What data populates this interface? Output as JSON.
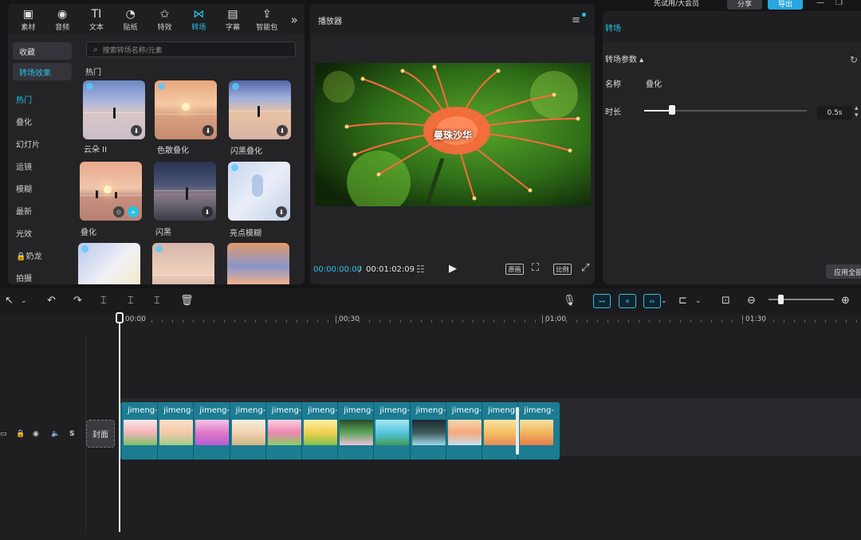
{
  "header": {
    "vip_text": "先试用/大会员",
    "share_label": "分享",
    "export_label": "导出"
  },
  "tabs": [
    {
      "label": "素材",
      "icon": "media-icon"
    },
    {
      "label": "音频",
      "icon": "audio-icon"
    },
    {
      "label": "文本",
      "icon": "text-icon",
      "glyph": "TI"
    },
    {
      "label": "贴纸",
      "icon": "sticker-icon"
    },
    {
      "label": "特效",
      "icon": "effects-icon"
    },
    {
      "label": "转场",
      "icon": "transition-icon",
      "active": true
    },
    {
      "label": "字幕",
      "icon": "subtitle-icon"
    },
    {
      "label": "智能包",
      "icon": "smart-pack-icon"
    }
  ],
  "sidebar": {
    "collect": "收藏",
    "transition_effects": "转场效果",
    "items": [
      "热门",
      "叠化",
      "幻灯片",
      "运镜",
      "模糊",
      "最新",
      "光效",
      "🔒奶龙",
      "拍摄"
    ]
  },
  "search": {
    "placeholder": "搜索转场名称/元素"
  },
  "section_title": "热门",
  "cards": [
    {
      "label": "云朵 II"
    },
    {
      "label": "色散叠化"
    },
    {
      "label": "闪黑叠化"
    },
    {
      "label": "叠化"
    },
    {
      "label": "闪黑"
    },
    {
      "label": "亮点模糊"
    }
  ],
  "player": {
    "title": "播放器",
    "caption": "曼珠沙华",
    "current_time": "00:00:00:00",
    "separator": "/",
    "total_time": "00:01:02:09",
    "btn_original": "原画",
    "btn_ratio": "比例"
  },
  "props": {
    "title": "转场",
    "param_title": "转场参数 ▴",
    "name_key": "名称",
    "name_value": "叠化",
    "duration_key": "时长",
    "duration_value": "0.5s",
    "duration_fraction": 0.17,
    "apply_all": "应用全部"
  },
  "timeline": {
    "ruler_labels": [
      "00:00",
      "00:30",
      "01:00",
      "01:30"
    ],
    "cover_label": "封面",
    "clips": [
      {
        "label": "jimeng-"
      },
      {
        "label": "jimeng-"
      },
      {
        "label": "jimeng-"
      },
      {
        "label": "jimeng-"
      },
      {
        "label": "jimeng-"
      },
      {
        "label": "jimeng-"
      },
      {
        "label": "jimeng-"
      },
      {
        "label": "jimeng-"
      },
      {
        "label": "jimeng-"
      },
      {
        "label": "jimeng-"
      },
      {
        "label": "jimeng-"
      },
      {
        "label": "jimeng-"
      }
    ]
  },
  "colors": {
    "accent": "#27c3e6",
    "clip": "#1c7c92",
    "panel": "#242427"
  }
}
